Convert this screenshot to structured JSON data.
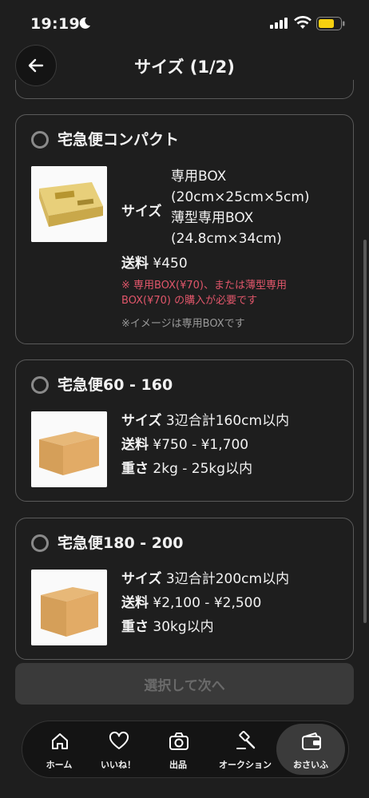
{
  "status": {
    "time": "19:19"
  },
  "header": {
    "title": "サイズ (1/2)"
  },
  "options": [
    {
      "title": "宅急便コンパクト",
      "size_label": "サイズ",
      "size_lines": [
        "専用BOX",
        "(20cm×25cm×5cm)",
        "薄型専用BOX",
        "(24.8cm×34cm)"
      ],
      "fee_label": "送料",
      "fee": "¥450",
      "note_red_1": "※ 専用BOX(¥70)、または薄型専用",
      "note_red_2": "BOX(¥70) の購入が必要です",
      "note_gray": "※イメージは専用BOXです",
      "selected": false
    },
    {
      "title": "宅急便60 - 160",
      "size_label": "サイズ",
      "size_value": "3辺合計160cm以内",
      "fee_label": "送料",
      "fee": "¥750 - ¥1,700",
      "weight_label": "重さ",
      "weight": "2kg - 25kg以内",
      "selected": false
    },
    {
      "title": "宅急便180 - 200",
      "size_label": "サイズ",
      "size_value": "3辺合計200cm以内",
      "fee_label": "送料",
      "fee": "¥2,100 - ¥2,500",
      "weight_label": "重さ",
      "weight": "30kg以内",
      "selected": false
    }
  ],
  "next_button": {
    "label": "選択して次へ",
    "enabled": false
  },
  "tabs": [
    {
      "label": "ホーム",
      "icon": "home-icon"
    },
    {
      "label": "いいね！",
      "icon": "heart-icon"
    },
    {
      "label": "出品",
      "icon": "camera-icon"
    },
    {
      "label": "オークション",
      "icon": "gavel-icon"
    },
    {
      "label": "おさいふ",
      "icon": "wallet-icon",
      "active": true
    }
  ],
  "colors": {
    "background": "#1e1e1e",
    "note_red": "#e0566a",
    "battery": "#f5d00f"
  }
}
